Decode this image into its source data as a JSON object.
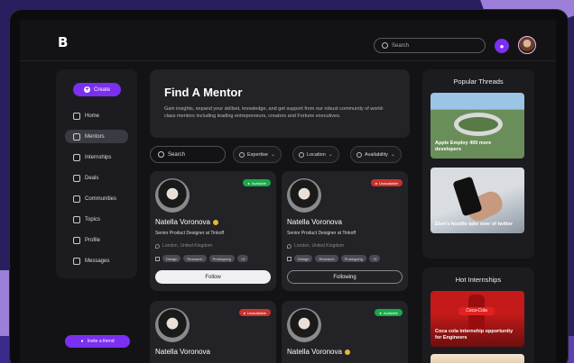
{
  "app": {
    "logo_text": "B",
    "search_placeholder": "Search"
  },
  "sidebar": {
    "create_label": "Create",
    "items": [
      {
        "label": "Home",
        "icon": "home-icon",
        "active": false
      },
      {
        "label": "Mentors",
        "icon": "mentors-icon",
        "active": true
      },
      {
        "label": "Internships",
        "icon": "internships-icon",
        "active": false
      },
      {
        "label": "Deals",
        "icon": "deals-icon",
        "active": false
      },
      {
        "label": "Communities",
        "icon": "communities-icon",
        "active": false
      },
      {
        "label": "Topics",
        "icon": "topics-icon",
        "active": false
      },
      {
        "label": "Profile",
        "icon": "profile-icon",
        "active": false
      },
      {
        "label": "Messages",
        "icon": "messages-icon",
        "active": false
      }
    ],
    "invite_label": "Invite a friend"
  },
  "main": {
    "title": "Find A Mentor",
    "description": "Gain insights, expand your skillset, knowledge, and get support from our robust community of world-class mentors including leading entrepreneurs, creators and Fortune executives.",
    "filters": {
      "search_placeholder": "Search",
      "expertise": "Expertise",
      "location": "Location",
      "availability": "Availability"
    },
    "mentors": [
      {
        "name": "Natella Voronova",
        "role": "Senior Product Designer at Tinkoff",
        "location": "London, United Kingdom",
        "status": "Available",
        "tags": [
          "Design",
          "Research",
          "Prototyping",
          "+3"
        ],
        "action": "Follow",
        "verified": true
      },
      {
        "name": "Natella Voronova",
        "role": "Senior Product Designer at Tinkoff",
        "location": "London, United Kingdom",
        "status": "Unavailable",
        "tags": [
          "Design",
          "Research",
          "Prototyping",
          "+3"
        ],
        "action": "Following",
        "verified": false
      },
      {
        "name": "Natella Voronova",
        "status": "Unavailable",
        "verified": false
      },
      {
        "name": "Natella Voronova",
        "status": "Available",
        "verified": true
      }
    ]
  },
  "right": {
    "threads_title": "Popular Threads",
    "threads": [
      {
        "caption": "Apple Employ 400 more developers"
      },
      {
        "caption": "Elon's hostile take over of twitter"
      }
    ],
    "internships_title": "Hot Internships",
    "internships": [
      {
        "caption": "Coca cola internship opportunity for Engineers",
        "logo_text": "Coca-Cola"
      }
    ]
  },
  "colors": {
    "accent": "#7b2ff0",
    "available": "#19a94b",
    "unavailable": "#c7332e"
  }
}
